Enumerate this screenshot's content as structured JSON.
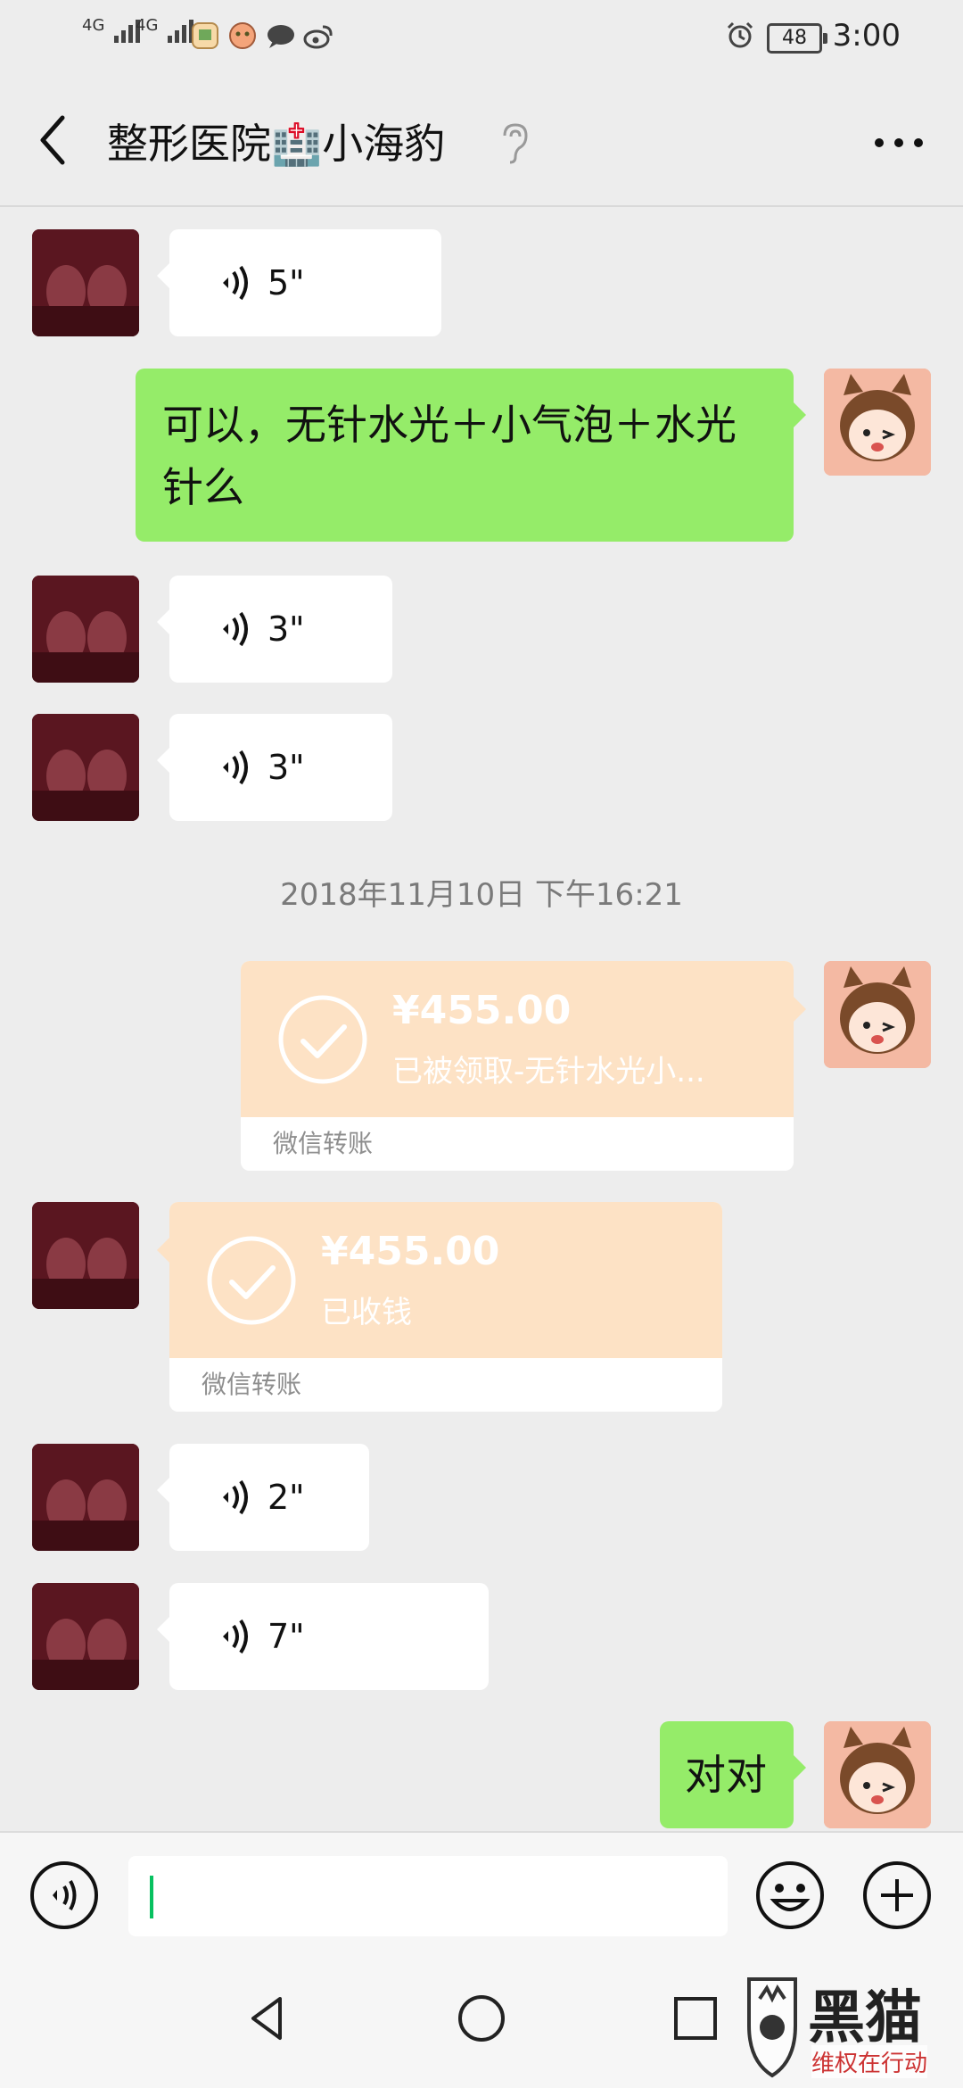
{
  "status_bar": {
    "network1": "4G",
    "network2": "4G",
    "battery": "48",
    "time": "3:00"
  },
  "header": {
    "title": "整形医院🏥小海豹"
  },
  "messages": [
    {
      "type": "voice",
      "side": "left",
      "duration": "5\""
    },
    {
      "type": "text",
      "side": "right",
      "text": "可以，无针水光＋小气泡＋水光针么"
    },
    {
      "type": "voice",
      "side": "left",
      "duration": "3\""
    },
    {
      "type": "voice",
      "side": "left",
      "duration": "3\""
    },
    {
      "type": "timestamp",
      "text": "2018年11月10日 下午16:21"
    },
    {
      "type": "transfer",
      "side": "right",
      "amount": "¥455.00",
      "note": "已被领取-无针水光小...",
      "footer": "微信转账"
    },
    {
      "type": "transfer",
      "side": "left",
      "amount": "¥455.00",
      "note": "已收钱",
      "footer": "微信转账"
    },
    {
      "type": "voice",
      "side": "left",
      "duration": "2\""
    },
    {
      "type": "voice",
      "side": "left",
      "duration": "7\""
    },
    {
      "type": "text",
      "side": "right",
      "text": "对对"
    }
  ],
  "input": {
    "value": ""
  },
  "watermark": {
    "text": "黑猫",
    "subtext": "维权在行动"
  },
  "colors": {
    "background": "#ededed",
    "green_bubble": "#95ec69",
    "transfer_bg": "#fde2c5",
    "cursor": "#07c160"
  }
}
